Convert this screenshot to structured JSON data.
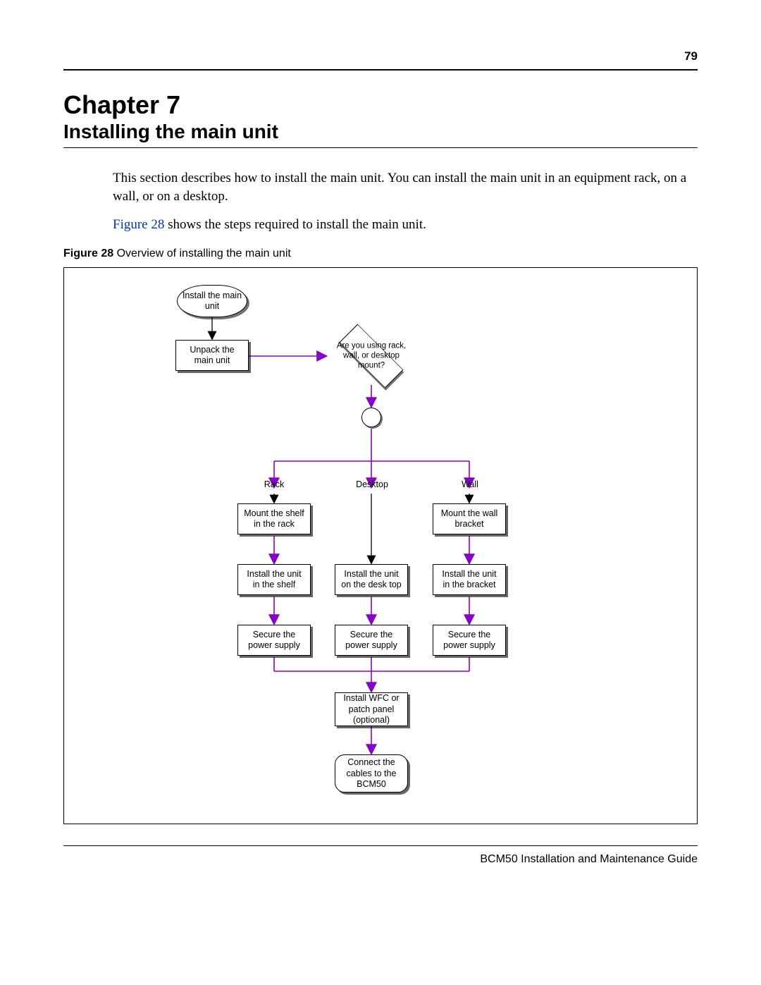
{
  "page_number": "79",
  "chapter": {
    "title": "Chapter 7",
    "subtitle": "Installing the main unit"
  },
  "paragraphs": {
    "intro": "This section describes how to install the main unit. You can install the main unit in an equipment rack, on a wall, or on a desktop.",
    "fig_link_text": "Figure 28",
    "after_figlink": " shows the steps required to install the main unit."
  },
  "figure": {
    "caption_bold": "Figure 28",
    "caption_rest": "   Overview of installing the main unit",
    "nodes": {
      "start": "Install the main unit",
      "unpack": "Unpack the main unit",
      "decision": "Are you using rack, wall, or desktop mount?",
      "branch_rack": "Rack",
      "branch_desktop": "Desktop",
      "branch_wall": "Wall",
      "rack_mount": "Mount the shelf in the rack",
      "wall_mount": "Mount the wall bracket",
      "rack_install": "Install the unit in the shelf",
      "desktop_install": "Install the unit on the desk top",
      "wall_install": "Install the unit in the bracket",
      "rack_secure": "Secure the power supply",
      "desktop_secure": "Secure the power supply",
      "wall_secure": "Secure the power supply",
      "install_wfc": "Install WFC or patch panel (optional)",
      "connect": "Connect the cables to the BCM50"
    }
  },
  "footer": "BCM50 Installation and Maintenance Guide"
}
